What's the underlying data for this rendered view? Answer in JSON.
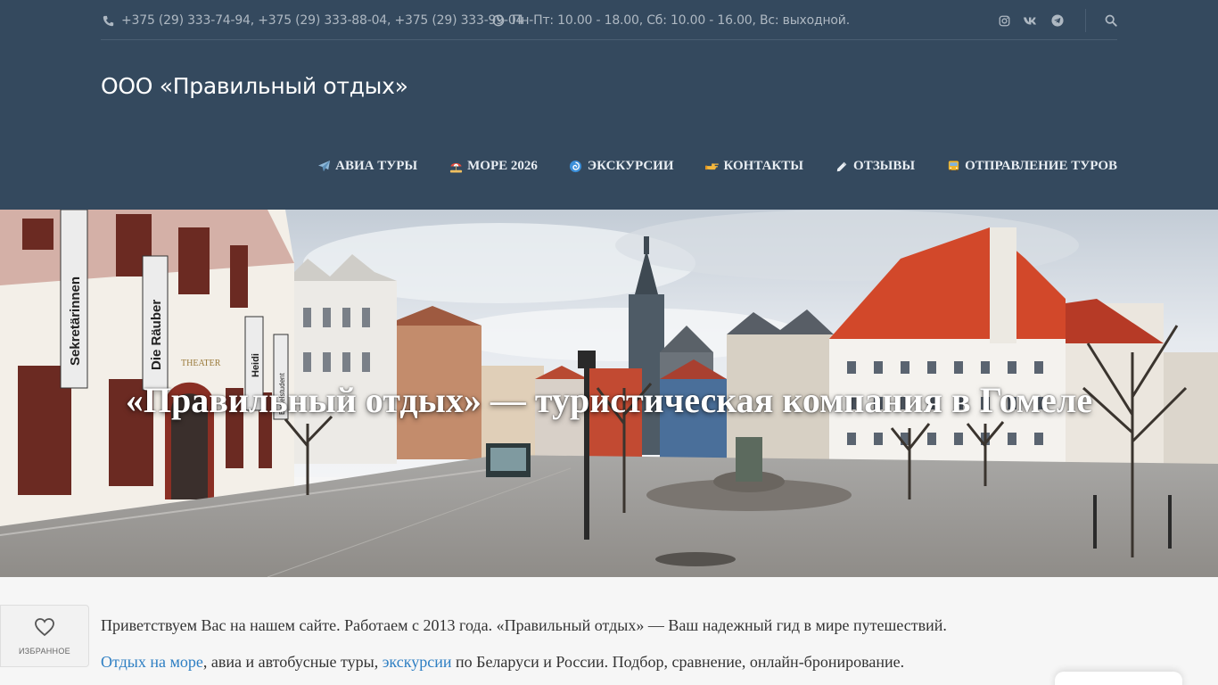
{
  "topbar": {
    "phones": "+375 (29) 333-74-94, +375 (29) 333-88-04, +375 (29) 333-99-04",
    "hours": "Пн-Пт: 10.00 - 18.00, Сб: 10.00 - 16.00, Вс: выходной.",
    "icons": [
      "phone-icon",
      "clock-icon",
      "instagram-icon",
      "vk-icon",
      "telegram-icon",
      "search-icon"
    ]
  },
  "brand": {
    "name": "ООО «Правильный отдых»"
  },
  "nav": {
    "items": [
      {
        "icon": "airplane-icon",
        "label": "АВИА ТУРЫ"
      },
      {
        "icon": "beach-umbrella-icon",
        "label": "МОРЕ 2026"
      },
      {
        "icon": "cyclone-icon",
        "label": "ЭКСКУРСИИ"
      },
      {
        "icon": "pointing-hand-icon",
        "label": "КОНТАКТЫ"
      },
      {
        "icon": "pencil-icon",
        "label": "ОТЗЫВЫ"
      },
      {
        "icon": "bus-icon",
        "label": "ОТПРАВЛЕНИЕ ТУРОВ"
      }
    ]
  },
  "hero": {
    "title": "«Правильный отдых» — туристическая компания в Гомеле",
    "signs": [
      "Sekretärinnen",
      "Die Räuber",
      "Heidi",
      "Bettelstudent",
      "THEATER"
    ]
  },
  "favorites": {
    "label": "ИЗБРАННОЕ"
  },
  "content": {
    "p1": "Приветствуем Вас на нашем сайте. Работаем с 2013 года. «Правильный отдых» — Ваш надежный гид в мире путешествий.",
    "p2_link1": "Отдых на море",
    "p2_text1": ", авиа и автобусные туры, ",
    "p2_link2": "экскурсии",
    "p2_text2": " по Беларуси и России.  Подбор, сравнение, онлайн-бронирование."
  },
  "colors": {
    "header_bg": "#34495e",
    "link": "#2e7fc3",
    "text": "#333333"
  }
}
